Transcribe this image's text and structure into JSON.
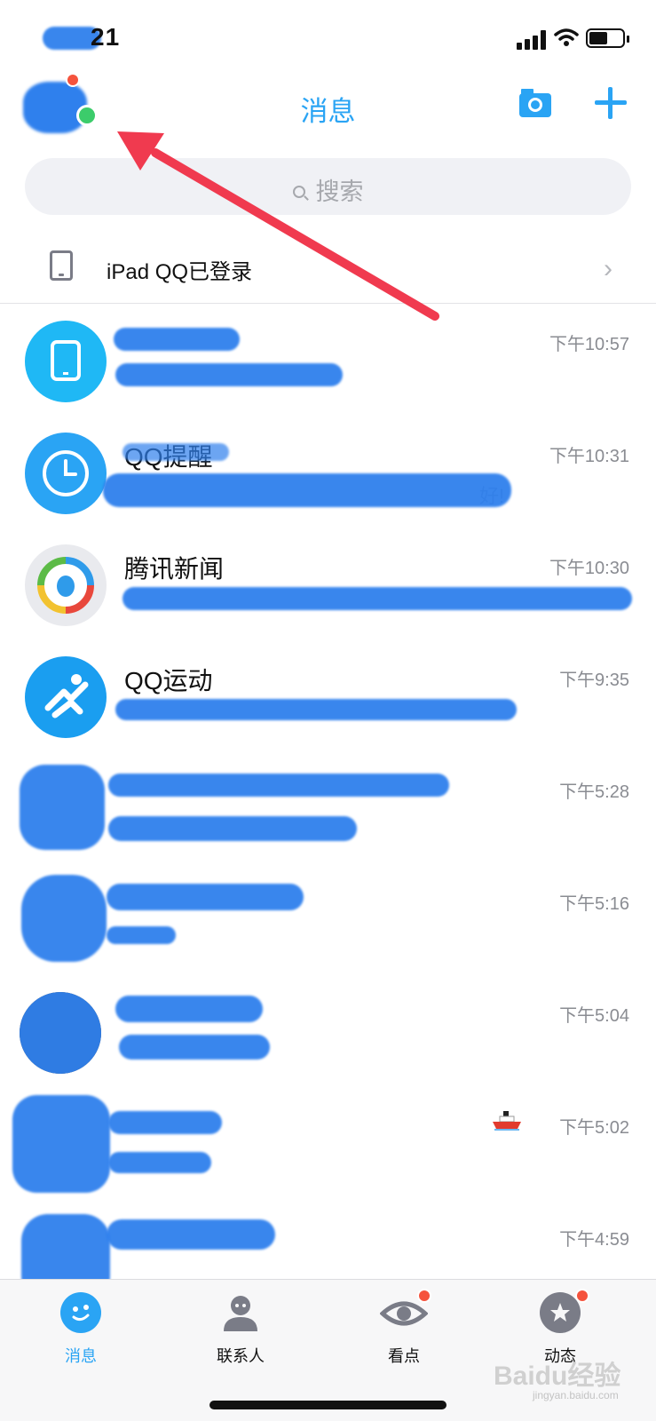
{
  "status_bar": {
    "time": "21",
    "signal_icon": "cellular-signal-icon",
    "wifi_icon": "wifi-icon",
    "battery_icon": "battery-icon"
  },
  "header": {
    "title": "消息",
    "camera_icon": "camera-icon",
    "add_icon": "plus-icon"
  },
  "search": {
    "placeholder": "搜索",
    "icon": "search-icon"
  },
  "device_row": {
    "label": "iPad QQ已登录",
    "icon": "tablet-icon"
  },
  "messages": [
    {
      "name": "",
      "time": "下午10:57",
      "preview": "",
      "avatar": "tablet-avatar",
      "avatar_color": "#1fb8f5"
    },
    {
      "name": "QQ提醒",
      "time": "下午10:31",
      "preview": "好!",
      "avatar": "clock-avatar",
      "avatar_color": "#2aa4f4"
    },
    {
      "name": "腾讯新闻",
      "time": "下午10:30",
      "preview": "",
      "avatar": "tencent-news-avatar"
    },
    {
      "name": "QQ运动",
      "time": "下午9:35",
      "preview": "",
      "avatar": "qq-sport-avatar",
      "avatar_color": "#1a9ef0"
    },
    {
      "name": "",
      "time": "下午5:28",
      "preview": "",
      "avatar": "contact-avatar"
    },
    {
      "name": "",
      "time": "下午5:16",
      "preview": "",
      "avatar": "contact-avatar"
    },
    {
      "name": "",
      "time": "下午5:04",
      "preview": "",
      "avatar": "contact-avatar"
    },
    {
      "name": "",
      "time": "下午5:02",
      "preview": "",
      "avatar": "contact-avatar",
      "extra_icon": "ship-icon"
    },
    {
      "name": "",
      "time": "下午4:59",
      "preview": "",
      "avatar": "contact-avatar"
    }
  ],
  "tabs": [
    {
      "label": "消息",
      "icon": "message-bubble-icon",
      "active": true
    },
    {
      "label": "联系人",
      "icon": "contacts-icon",
      "active": false
    },
    {
      "label": "看点",
      "icon": "eye-icon",
      "active": false,
      "badge": true
    },
    {
      "label": "动态",
      "icon": "star-icon",
      "active": false,
      "badge": true
    }
  ],
  "watermark": {
    "text": "Baidu经验",
    "sub": "jingyan.baidu.com"
  },
  "colors": {
    "accent": "#2aa4f4",
    "scribble": "#2f80ed",
    "annotation_arrow": "#f03a4f",
    "badge": "#f5533d"
  }
}
